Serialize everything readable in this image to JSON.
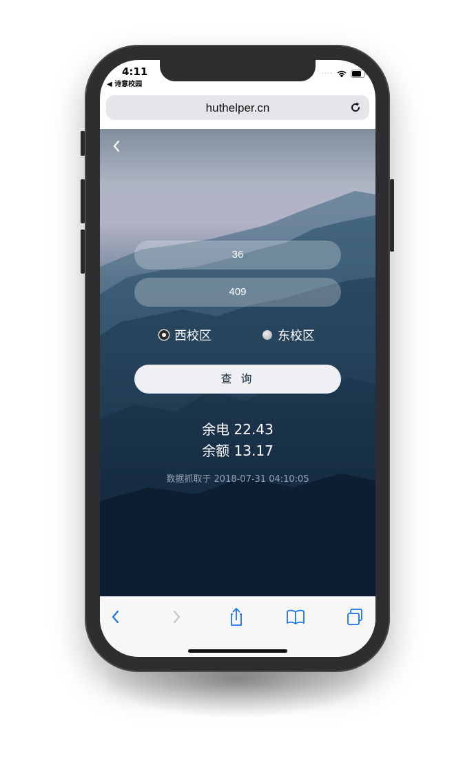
{
  "status_bar": {
    "time": "4:11",
    "back_app": "◀ 诗意校园"
  },
  "browser": {
    "url": "huthelper.cn"
  },
  "form": {
    "building": "36",
    "room": "409",
    "campus_options": [
      {
        "label": "西校区",
        "selected": true
      },
      {
        "label": "东校区",
        "selected": false
      }
    ],
    "query_label": "查 询"
  },
  "result": {
    "electricity": "余电 22.43",
    "balance": "余额 13.17",
    "fetched_at": "数据抓取于 2018-07-31 04:10:05"
  },
  "colors": {
    "accent": "#1a73e8",
    "button_text": "#1c2b3c"
  },
  "icons": [
    "back-icon",
    "forward-icon",
    "share-icon",
    "bookmarks-icon",
    "tabs-icon",
    "reload-icon",
    "wifi-icon",
    "battery-icon"
  ]
}
